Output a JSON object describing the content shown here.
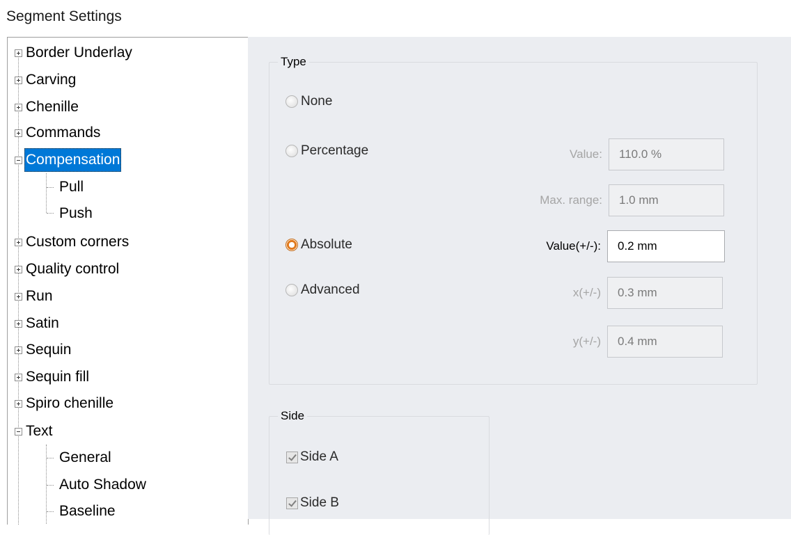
{
  "window": {
    "title": "Segment Settings"
  },
  "tree": {
    "items": [
      {
        "label": "Border Underlay",
        "expander": "plus"
      },
      {
        "label": "Carving",
        "expander": "plus"
      },
      {
        "label": "Chenille",
        "expander": "plus"
      },
      {
        "label": "Commands",
        "expander": "plus"
      },
      {
        "label": "Compensation",
        "expander": "minus",
        "selected": true
      },
      {
        "label": "Pull",
        "child": true
      },
      {
        "label": "Push",
        "child": true
      },
      {
        "label": "Custom corners",
        "expander": "plus"
      },
      {
        "label": "Quality control",
        "expander": "plus"
      },
      {
        "label": "Run",
        "expander": "plus"
      },
      {
        "label": "Satin",
        "expander": "plus"
      },
      {
        "label": "Sequin",
        "expander": "plus"
      },
      {
        "label": "Sequin fill",
        "expander": "plus"
      },
      {
        "label": "Spiro chenille",
        "expander": "plus"
      },
      {
        "label": "Text",
        "expander": "minus"
      },
      {
        "label": "General",
        "child": true
      },
      {
        "label": "Auto Shadow",
        "child": true
      },
      {
        "label": "Baseline",
        "child": true
      }
    ]
  },
  "type_group": {
    "title": "Type",
    "options": {
      "none": "None",
      "percentage": "Percentage",
      "absolute": "Absolute",
      "advanced": "Advanced"
    },
    "selected": "Absolute",
    "fields": {
      "value_label": "Value:",
      "value": "110.0 %",
      "max_range_label": "Max. range:",
      "max_range": "1.0 mm",
      "abs_value_label": "Value(+/-):",
      "abs_value": "0.2 mm",
      "x_label": "x(+/-)",
      "x_value": "0.3 mm",
      "y_label": "y(+/-)",
      "y_value": "0.4 mm"
    }
  },
  "side_group": {
    "title": "Side",
    "side_a": "Side A",
    "side_a_checked": true,
    "side_b": "Side B",
    "side_b_checked": true
  },
  "colors": {
    "selection": "#0078d7",
    "panel_bg": "#ebedf1",
    "radio_accent": "#e07a1e"
  }
}
